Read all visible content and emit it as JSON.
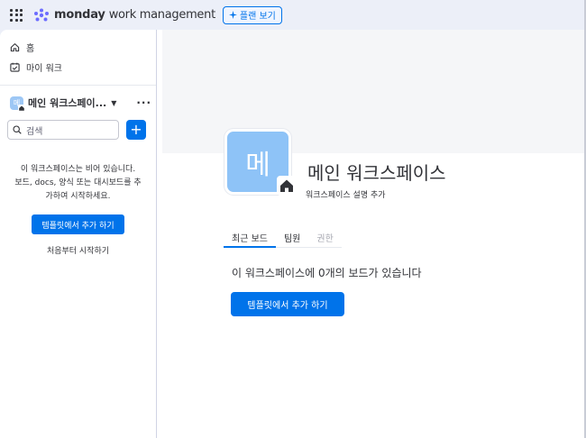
{
  "topbar": {
    "brand": "monday",
    "brand_sub": "work management",
    "plans_button": "플랜 보기"
  },
  "sidebar": {
    "nav": [
      {
        "label": "홈",
        "icon": "home-icon"
      },
      {
        "label": "마이 워크",
        "icon": "calendar-check-icon"
      }
    ],
    "workspace": {
      "name": "메인 워크스페이...",
      "badge_letter": "메"
    },
    "search": {
      "placeholder": "검색"
    },
    "empty": {
      "line1": "이 워크스페이스는 비어 있습니다.",
      "line2": "보드, docs, 양식 또는 대시보드를 추",
      "line3": "가하여 시작하세요.",
      "template_button": "템플릿에서 추가 하기",
      "start_link": "처음부터 시작하기"
    }
  },
  "content": {
    "badge_letter": "메",
    "title": "메인 워크스페이스",
    "description": "워크스페이스 설명 추가",
    "tabs": [
      {
        "label": "최근 보드",
        "state": "active"
      },
      {
        "label": "팀원",
        "state": "normal"
      },
      {
        "label": "권한",
        "state": "disabled"
      }
    ],
    "empty_message": "이 워크스페이스에 0개의 보드가 있습니다",
    "template_button": "템플릿에서 추가 하기"
  },
  "colors": {
    "accent": "#0073ea",
    "badge": "#8ec3f7",
    "background": "#eceff8"
  }
}
